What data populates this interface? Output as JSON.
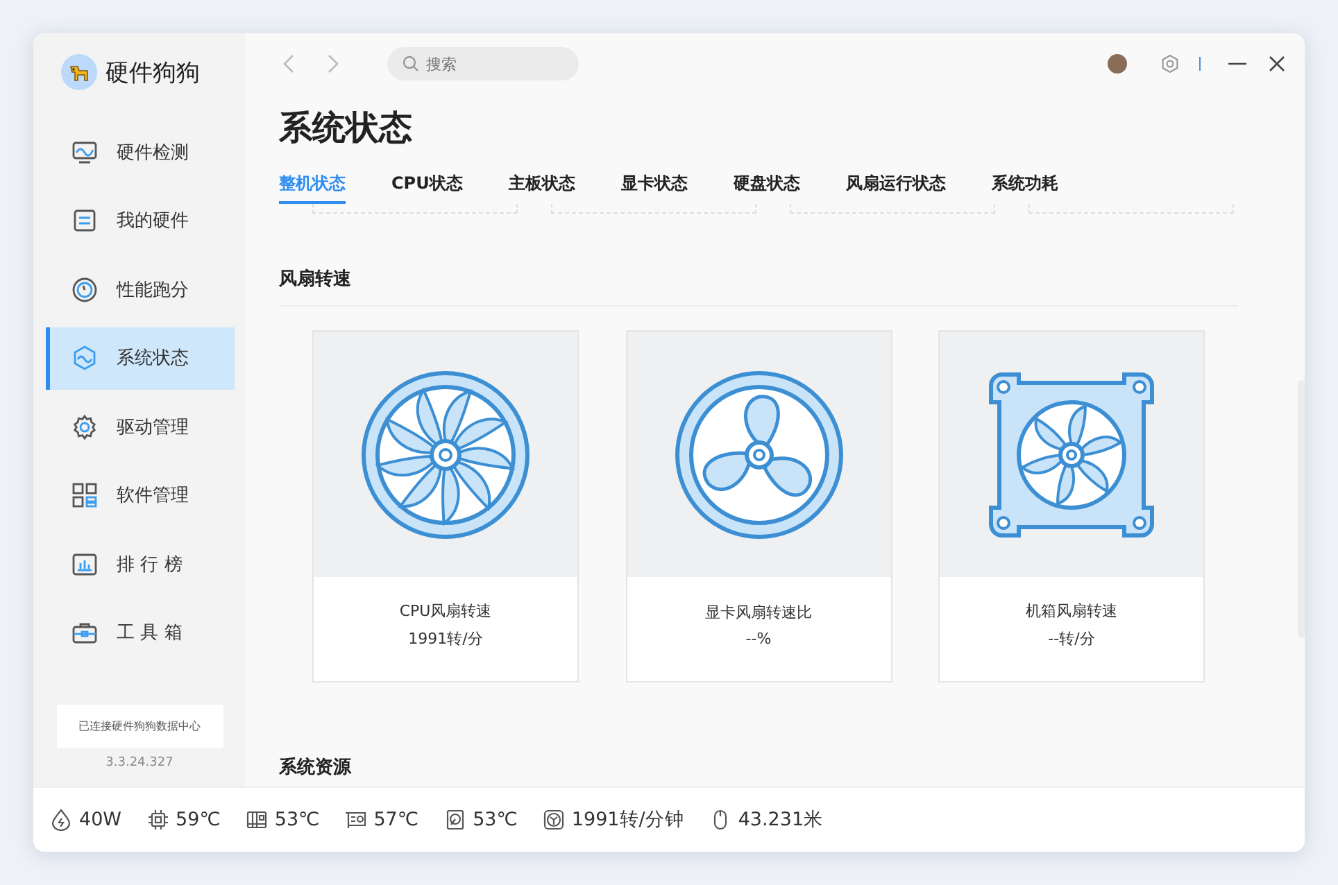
{
  "app": {
    "name": "硬件狗狗"
  },
  "sidebar": {
    "items": [
      {
        "kind": "monitor",
        "label": "硬件检测",
        "selected": false
      },
      {
        "kind": "board",
        "label": "我的硬件",
        "selected": false
      },
      {
        "kind": "gauge",
        "label": "性能跑分",
        "selected": false
      },
      {
        "kind": "status",
        "label": "系统状态",
        "selected": true
      },
      {
        "kind": "gear",
        "label": "驱动管理",
        "selected": false
      },
      {
        "kind": "apps",
        "label": "软件管理",
        "selected": false
      },
      {
        "kind": "chart",
        "label": "排 行 榜",
        "selected": false
      },
      {
        "kind": "toolbox",
        "label": "工 具 箱",
        "selected": false
      }
    ],
    "connection": "已连接硬件狗狗数据中心",
    "version": "3.3.24.327"
  },
  "search": {
    "placeholder": "搜索"
  },
  "page_title": "系统状态",
  "tabs": [
    {
      "label": "整机状态",
      "selected": true
    },
    {
      "label": "CPU状态",
      "selected": false
    },
    {
      "label": "主板状态",
      "selected": false
    },
    {
      "label": "显卡状态",
      "selected": false
    },
    {
      "label": "硬盘状态",
      "selected": false
    },
    {
      "label": "风扇运行状态",
      "selected": false
    },
    {
      "label": "系统功耗",
      "selected": false
    }
  ],
  "fan_section": {
    "title": "风扇转速",
    "cards": [
      {
        "kind": "cpu",
        "label": "CPU风扇转速",
        "value": "1991转/分"
      },
      {
        "kind": "gpu",
        "label": "显卡风扇转速比",
        "value": "--%"
      },
      {
        "kind": "case",
        "label": "机箱风扇转速",
        "value": "--转/分"
      }
    ]
  },
  "next_section": {
    "title": "系统资源"
  },
  "status_bar": [
    {
      "kind": "power",
      "text": "40W"
    },
    {
      "kind": "cpu",
      "text": "59℃"
    },
    {
      "kind": "board",
      "text": "53℃"
    },
    {
      "kind": "gpu",
      "text": "57℃"
    },
    {
      "kind": "disk",
      "text": "53℃"
    },
    {
      "kind": "fan",
      "text": "1991转/分钟"
    },
    {
      "kind": "mouse",
      "text": "43.231米"
    }
  ]
}
